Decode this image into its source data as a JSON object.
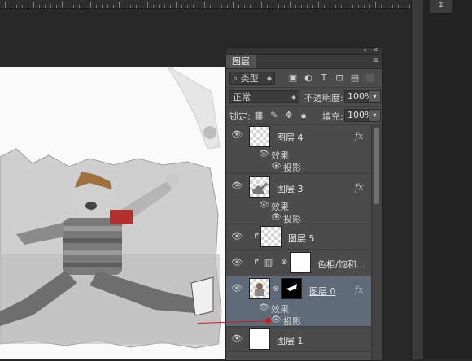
{
  "panel": {
    "title": "图层",
    "filter_label": "类型",
    "blend_mode": "正常",
    "opacity_label": "不透明度:",
    "opacity_value": "100%",
    "lock_label": "锁定:",
    "fill_label": "填充:",
    "fill_value": "100%"
  },
  "layers": [
    {
      "name": "图层 4",
      "has_fx": true,
      "effects_label": "效果",
      "effect": "投影",
      "thumb": "transparent"
    },
    {
      "name": "图层 3",
      "has_fx": true,
      "effects_label": "效果",
      "effect": "投影",
      "thumb": "figure"
    },
    {
      "name": "图层 5",
      "clipped": true,
      "thumb": "transparent"
    },
    {
      "name": "色相/饱和...",
      "clipped": true,
      "adjustment": true,
      "thumb": "white"
    },
    {
      "name": "图层 0",
      "selected": true,
      "has_fx": true,
      "effects_label": "效果",
      "effect": "投影",
      "thumb": "photo",
      "mask": true
    },
    {
      "name": "图层 1",
      "thumb": "white"
    }
  ],
  "colors": {
    "panel_bg": "#4b4b4b",
    "selected_row": "#5e6a78",
    "annotation": "#d41b1b"
  },
  "icons": [
    "eye-icon",
    "fx-icon",
    "lock-icon",
    "chain-icon",
    "move-icon",
    "brush-icon",
    "menu-icon",
    "search-icon"
  ]
}
